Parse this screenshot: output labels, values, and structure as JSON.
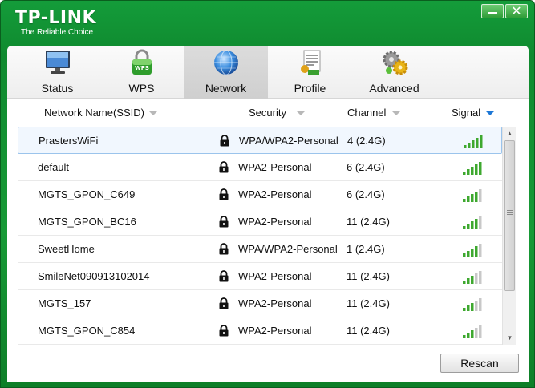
{
  "app": {
    "brand": "TP-LINK",
    "tagline": "The Reliable Choice",
    "accent_color": "#149c3a"
  },
  "window_controls": {
    "minimize_icon": "minimize-icon",
    "close_icon": "close-icon",
    "close_glyph": "✕"
  },
  "tabs": [
    {
      "label": "Status",
      "icon": "monitor-icon",
      "active": false
    },
    {
      "label": "WPS",
      "icon": "wps-lock-icon",
      "active": false
    },
    {
      "label": "Network",
      "icon": "globe-icon",
      "active": true
    },
    {
      "label": "Profile",
      "icon": "document-icon",
      "active": false
    },
    {
      "label": "Advanced",
      "icon": "gears-icon",
      "active": false
    }
  ],
  "columns": {
    "ssid": "Network Name(SSID)",
    "security": "Security",
    "channel": "Channel",
    "signal": "Signal",
    "sorted_by": "signal",
    "sort_color": "#1e78d6"
  },
  "networks": [
    {
      "ssid": "PrastersWiFi",
      "security": "WPA/WPA2-Personal",
      "channel": "4 (2.4G)",
      "signal_bars": 5,
      "selected": true
    },
    {
      "ssid": "default",
      "security": "WPA2-Personal",
      "channel": "6 (2.4G)",
      "signal_bars": 5,
      "selected": false
    },
    {
      "ssid": "MGTS_GPON_C649",
      "security": "WPA2-Personal",
      "channel": "6 (2.4G)",
      "signal_bars": 4,
      "selected": false
    },
    {
      "ssid": "MGTS_GPON_BC16",
      "security": "WPA2-Personal",
      "channel": "11 (2.4G)",
      "signal_bars": 4,
      "selected": false
    },
    {
      "ssid": "SweetHome",
      "security": "WPA/WPA2-Personal",
      "channel": "1 (2.4G)",
      "signal_bars": 4,
      "selected": false
    },
    {
      "ssid": "SmileNet090913102014",
      "security": "WPA2-Personal",
      "channel": "11 (2.4G)",
      "signal_bars": 3,
      "selected": false
    },
    {
      "ssid": "MGTS_157",
      "security": "WPA2-Personal",
      "channel": "11 (2.4G)",
      "signal_bars": 3,
      "selected": false
    },
    {
      "ssid": "MGTS_GPON_C854",
      "security": "WPA2-Personal",
      "channel": "11 (2.4G)",
      "signal_bars": 3,
      "selected": false
    }
  ],
  "signal_colors": {
    "on": "#3ea82f",
    "off": "#c8c8c8"
  },
  "rescan_label": "Rescan"
}
